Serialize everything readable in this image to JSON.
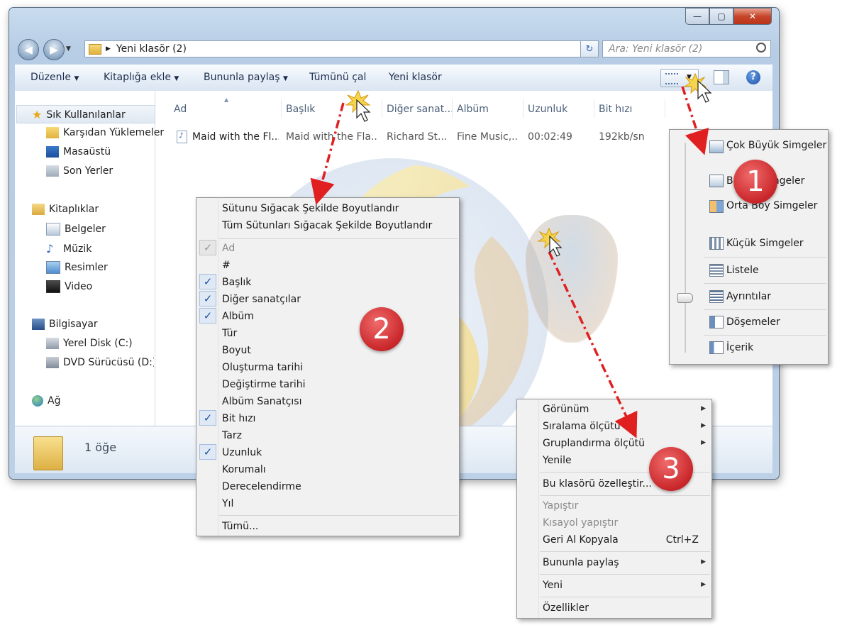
{
  "window": {
    "breadcrumb": "Yeni klasör (2)",
    "search_placeholder": "Ara: Yeni klasör (2)",
    "buttons": {
      "minimize": "—",
      "maximize": "▢",
      "close": "✕"
    }
  },
  "toolbar": {
    "organize": "Düzenle",
    "add_to_library": "Kitaplığa ekle",
    "share_with": "Bununla paylaş",
    "play_all": "Tümünü çal",
    "new_folder": "Yeni klasör"
  },
  "sidebar": {
    "favorites": "Sık Kullanılanlar",
    "downloads": "Karşıdan Yüklemeler",
    "desktop": "Masaüstü",
    "recent": "Son Yerler",
    "libraries": "Kitaplıklar",
    "documents": "Belgeler",
    "music": "Müzik",
    "pictures": "Resimler",
    "videos": "Video",
    "computer": "Bilgisayar",
    "local_disk": "Yerel Disk (C:)",
    "dvd": "DVD Sürücüsü (D:) G:",
    "network": "Ağ"
  },
  "columns": {
    "name": "Ad",
    "title": "Başlık",
    "artists": "Diğer sanat...",
    "album": "Albüm",
    "length": "Uzunluk",
    "bitrate": "Bit hızı"
  },
  "file": {
    "name": "Maid with the Fl...",
    "title": "Maid with the Fla...",
    "artist": "Richard St...",
    "album": "Fine Music,...",
    "length": "00:02:49",
    "bitrate": "192kb/sn"
  },
  "details": {
    "count": "1 öğe"
  },
  "column_menu": {
    "fit_column": "Sütunu Sığacak Şekilde Boyutlandır",
    "fit_all": "Tüm Sütunları Sığacak Şekilde Boyutlandır",
    "items": [
      {
        "label": "Ad",
        "checked": true,
        "disabled": true
      },
      {
        "label": "#",
        "checked": false
      },
      {
        "label": "Başlık",
        "checked": true
      },
      {
        "label": "Diğer sanatçılar",
        "checked": true
      },
      {
        "label": "Albüm",
        "checked": true
      },
      {
        "label": "Tür",
        "checked": false
      },
      {
        "label": "Boyut",
        "checked": false
      },
      {
        "label": "Oluşturma tarihi",
        "checked": false
      },
      {
        "label": "Değiştirme tarihi",
        "checked": false
      },
      {
        "label": "Albüm Sanatçısı",
        "checked": false
      },
      {
        "label": "Bit hızı",
        "checked": true
      },
      {
        "label": "Tarz",
        "checked": false
      },
      {
        "label": "Uzunluk",
        "checked": true
      },
      {
        "label": "Korumalı",
        "checked": false
      },
      {
        "label": "Derecelendirme",
        "checked": false
      },
      {
        "label": "Yıl",
        "checked": false
      }
    ],
    "more": "Tümü..."
  },
  "view_menu": {
    "extra_large": "Çok Büyük Simgeler",
    "large": "Büyük Simgeler",
    "medium": "Orta Boy Simgeler",
    "small": "Küçük Simgeler",
    "list": "Listele",
    "details": "Ayrıntılar",
    "tiles": "Döşemeler",
    "content": "İçerik"
  },
  "context_menu": {
    "view": "Görünüm",
    "sort_by": "Sıralama ölçütü",
    "group_by": "Gruplandırma ölçütü",
    "refresh": "Yenile",
    "customize": "Bu klasörü özelleştir...",
    "paste": "Yapıştır",
    "paste_shortcut": "Kısayol yapıştır",
    "undo": "Geri Al Kopyala",
    "undo_shortcut": "Ctrl+Z",
    "share_with": "Bununla paylaş",
    "new": "Yeni",
    "properties": "Özellikler"
  },
  "badges": {
    "one": "1",
    "two": "2",
    "three": "3"
  },
  "colors": {
    "badge": "#c9262a",
    "arrow": "#e02020",
    "accent": "#1d4f9b"
  }
}
